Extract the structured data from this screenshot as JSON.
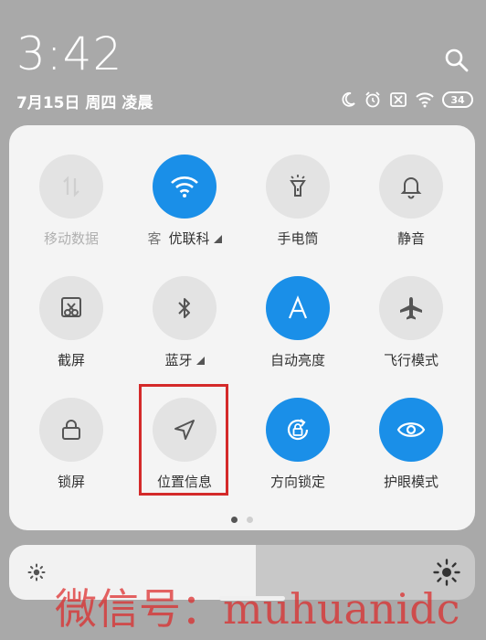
{
  "status": {
    "time": "3:42",
    "date": "7月15日 周四 凌晨",
    "battery": "34",
    "icons": [
      "moon-icon",
      "alarm-icon",
      "no-sim-icon",
      "wifi-icon",
      "battery-icon"
    ]
  },
  "colors": {
    "accent": "#1a8fe8",
    "tile_off": "#e3e3e3",
    "highlight": "#d42a2a",
    "watermark": "#dc2828"
  },
  "tiles": [
    {
      "label": "移动数据",
      "icon": "mobile-data-icon",
      "on": false,
      "disabled": true
    },
    {
      "label": "优联科",
      "label_prefix": "客",
      "icon": "wifi-icon",
      "on": true,
      "has_menu": true
    },
    {
      "label": "手电筒",
      "icon": "flashlight-icon",
      "on": false
    },
    {
      "label": "静音",
      "icon": "bell-icon",
      "on": false
    },
    {
      "label": "截屏",
      "icon": "screenshot-icon",
      "on": false
    },
    {
      "label": "蓝牙",
      "icon": "bluetooth-icon",
      "on": false,
      "has_menu": true
    },
    {
      "label": "自动亮度",
      "icon": "auto-brightness-icon",
      "on": true
    },
    {
      "label": "飞行模式",
      "icon": "airplane-icon",
      "on": false
    },
    {
      "label": "锁屏",
      "icon": "lock-icon",
      "on": false
    },
    {
      "label": "位置信息",
      "icon": "location-icon",
      "on": false,
      "highlighted": true
    },
    {
      "label": "方向锁定",
      "icon": "rotation-lock-icon",
      "on": true
    },
    {
      "label": "护眼模式",
      "icon": "eye-icon",
      "on": true
    }
  ],
  "pager": {
    "pages": 2,
    "current": 1
  },
  "brightness": {
    "level": 0.53
  },
  "watermark": "微信号：muhuanidc"
}
